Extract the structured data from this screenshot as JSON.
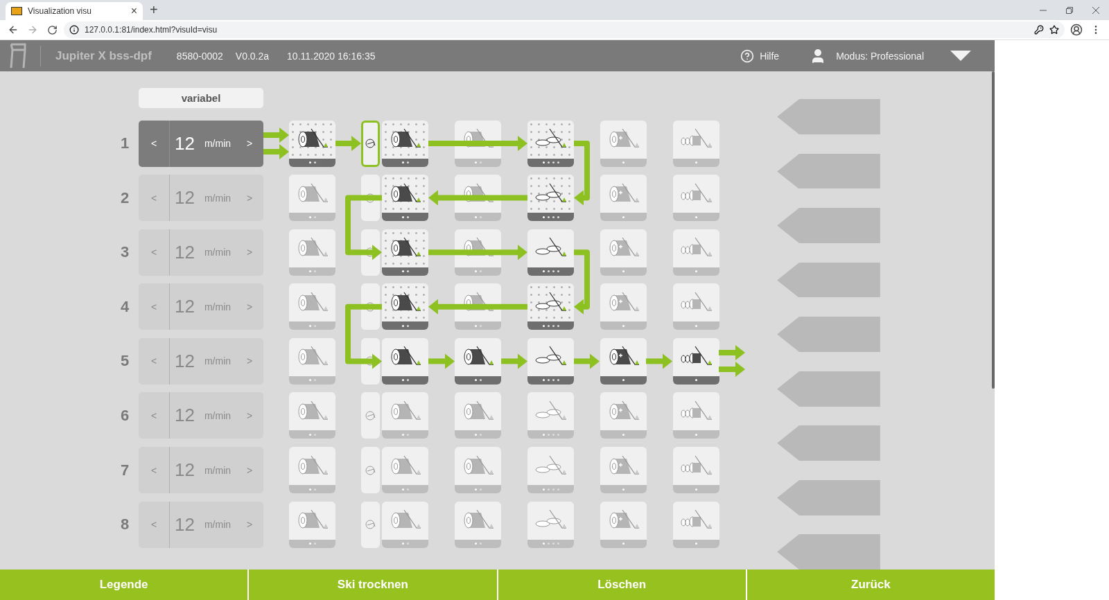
{
  "browser": {
    "tab_title": "Visualization visu",
    "tab_close": "×",
    "new_tab": "+",
    "url": "127.0.0.1:81/index.html?visuId=visu"
  },
  "header": {
    "title": "Jupiter X bss-dpf",
    "serial": "8580-0002",
    "version": "V0.0.2a",
    "datetime": "10.11.2020 16:16:35",
    "help": "Hilfe",
    "mode": "Modus: Professional"
  },
  "mode_label": "variabel",
  "columns": [
    {
      "kind": "unwind"
    },
    {
      "kind": "splice"
    },
    {
      "kind": "roll"
    },
    {
      "kind": "roll"
    },
    {
      "kind": "slit"
    },
    {
      "kind": "cut"
    },
    {
      "kind": "rewind"
    }
  ],
  "rows": [
    {
      "number": "1",
      "prev": "<",
      "speed": "12",
      "unit": "m/min",
      "next": ">",
      "selected": true,
      "tiles": [
        {
          "active": true,
          "dotted": true,
          "selected": false
        },
        {
          "active": true,
          "dotted": false,
          "selected": true
        },
        {
          "active": true,
          "dotted": true,
          "selected": false
        },
        {
          "active": false,
          "dotted": false,
          "selected": false
        },
        {
          "active": true,
          "dotted": true,
          "selected": false
        },
        {
          "active": false,
          "dotted": false,
          "selected": false
        },
        {
          "active": false,
          "dotted": false,
          "selected": false
        }
      ]
    },
    {
      "number": "2",
      "prev": "<",
      "speed": "12",
      "unit": "m/min",
      "next": ">",
      "selected": false,
      "tiles": [
        {
          "active": false,
          "dotted": false,
          "selected": false
        },
        {
          "active": false,
          "dotted": false,
          "selected": false
        },
        {
          "active": true,
          "dotted": true,
          "selected": false
        },
        {
          "active": false,
          "dotted": false,
          "selected": false
        },
        {
          "active": true,
          "dotted": true,
          "selected": false
        },
        {
          "active": false,
          "dotted": false,
          "selected": false
        },
        {
          "active": false,
          "dotted": false,
          "selected": false
        }
      ]
    },
    {
      "number": "3",
      "prev": "<",
      "speed": "12",
      "unit": "m/min",
      "next": ">",
      "selected": false,
      "tiles": [
        {
          "active": false,
          "dotted": false,
          "selected": false
        },
        {
          "active": false,
          "dotted": false,
          "selected": false
        },
        {
          "active": true,
          "dotted": true,
          "selected": false
        },
        {
          "active": false,
          "dotted": false,
          "selected": false
        },
        {
          "active": true,
          "dotted": false,
          "selected": false
        },
        {
          "active": false,
          "dotted": false,
          "selected": false
        },
        {
          "active": false,
          "dotted": false,
          "selected": false
        }
      ]
    },
    {
      "number": "4",
      "prev": "<",
      "speed": "12",
      "unit": "m/min",
      "next": ">",
      "selected": false,
      "tiles": [
        {
          "active": false,
          "dotted": false,
          "selected": false
        },
        {
          "active": false,
          "dotted": false,
          "selected": false
        },
        {
          "active": true,
          "dotted": true,
          "selected": false
        },
        {
          "active": false,
          "dotted": false,
          "selected": false
        },
        {
          "active": true,
          "dotted": true,
          "selected": false
        },
        {
          "active": false,
          "dotted": false,
          "selected": false
        },
        {
          "active": false,
          "dotted": false,
          "selected": false
        }
      ]
    },
    {
      "number": "5",
      "prev": "<",
      "speed": "12",
      "unit": "m/min",
      "next": ">",
      "selected": false,
      "tiles": [
        {
          "active": false,
          "dotted": false,
          "selected": false
        },
        {
          "active": false,
          "dotted": false,
          "selected": false
        },
        {
          "active": true,
          "dotted": false,
          "selected": false
        },
        {
          "active": true,
          "dotted": false,
          "selected": false
        },
        {
          "active": true,
          "dotted": false,
          "selected": false
        },
        {
          "active": true,
          "dotted": false,
          "selected": false
        },
        {
          "active": true,
          "dotted": false,
          "selected": false
        }
      ]
    },
    {
      "number": "6",
      "prev": "<",
      "speed": "12",
      "unit": "m/min",
      "next": ">",
      "selected": false,
      "tiles": [
        {
          "active": false,
          "dotted": false,
          "selected": false
        },
        {
          "active": false,
          "dotted": false,
          "selected": false
        },
        {
          "active": false,
          "dotted": false,
          "selected": false
        },
        {
          "active": false,
          "dotted": false,
          "selected": false
        },
        {
          "active": false,
          "dotted": false,
          "selected": false
        },
        {
          "active": false,
          "dotted": false,
          "selected": false
        },
        {
          "active": false,
          "dotted": false,
          "selected": false
        }
      ]
    },
    {
      "number": "7",
      "prev": "<",
      "speed": "12",
      "unit": "m/min",
      "next": ">",
      "selected": false,
      "tiles": [
        {
          "active": false,
          "dotted": false,
          "selected": false
        },
        {
          "active": false,
          "dotted": false,
          "selected": false
        },
        {
          "active": false,
          "dotted": false,
          "selected": false
        },
        {
          "active": false,
          "dotted": false,
          "selected": false
        },
        {
          "active": false,
          "dotted": false,
          "selected": false
        },
        {
          "active": false,
          "dotted": false,
          "selected": false
        },
        {
          "active": false,
          "dotted": false,
          "selected": false
        }
      ]
    },
    {
      "number": "8",
      "prev": "<",
      "speed": "12",
      "unit": "m/min",
      "next": ">",
      "selected": false,
      "tiles": [
        {
          "active": false,
          "dotted": false,
          "selected": false
        },
        {
          "active": false,
          "dotted": false,
          "selected": false
        },
        {
          "active": false,
          "dotted": false,
          "selected": false
        },
        {
          "active": false,
          "dotted": false,
          "selected": false
        },
        {
          "active": false,
          "dotted": false,
          "selected": false
        },
        {
          "active": false,
          "dotted": false,
          "selected": false
        },
        {
          "active": false,
          "dotted": false,
          "selected": false
        }
      ]
    }
  ],
  "footer_buttons": [
    "Legende",
    "Ski trocknen",
    "Löschen",
    "Zurück"
  ]
}
